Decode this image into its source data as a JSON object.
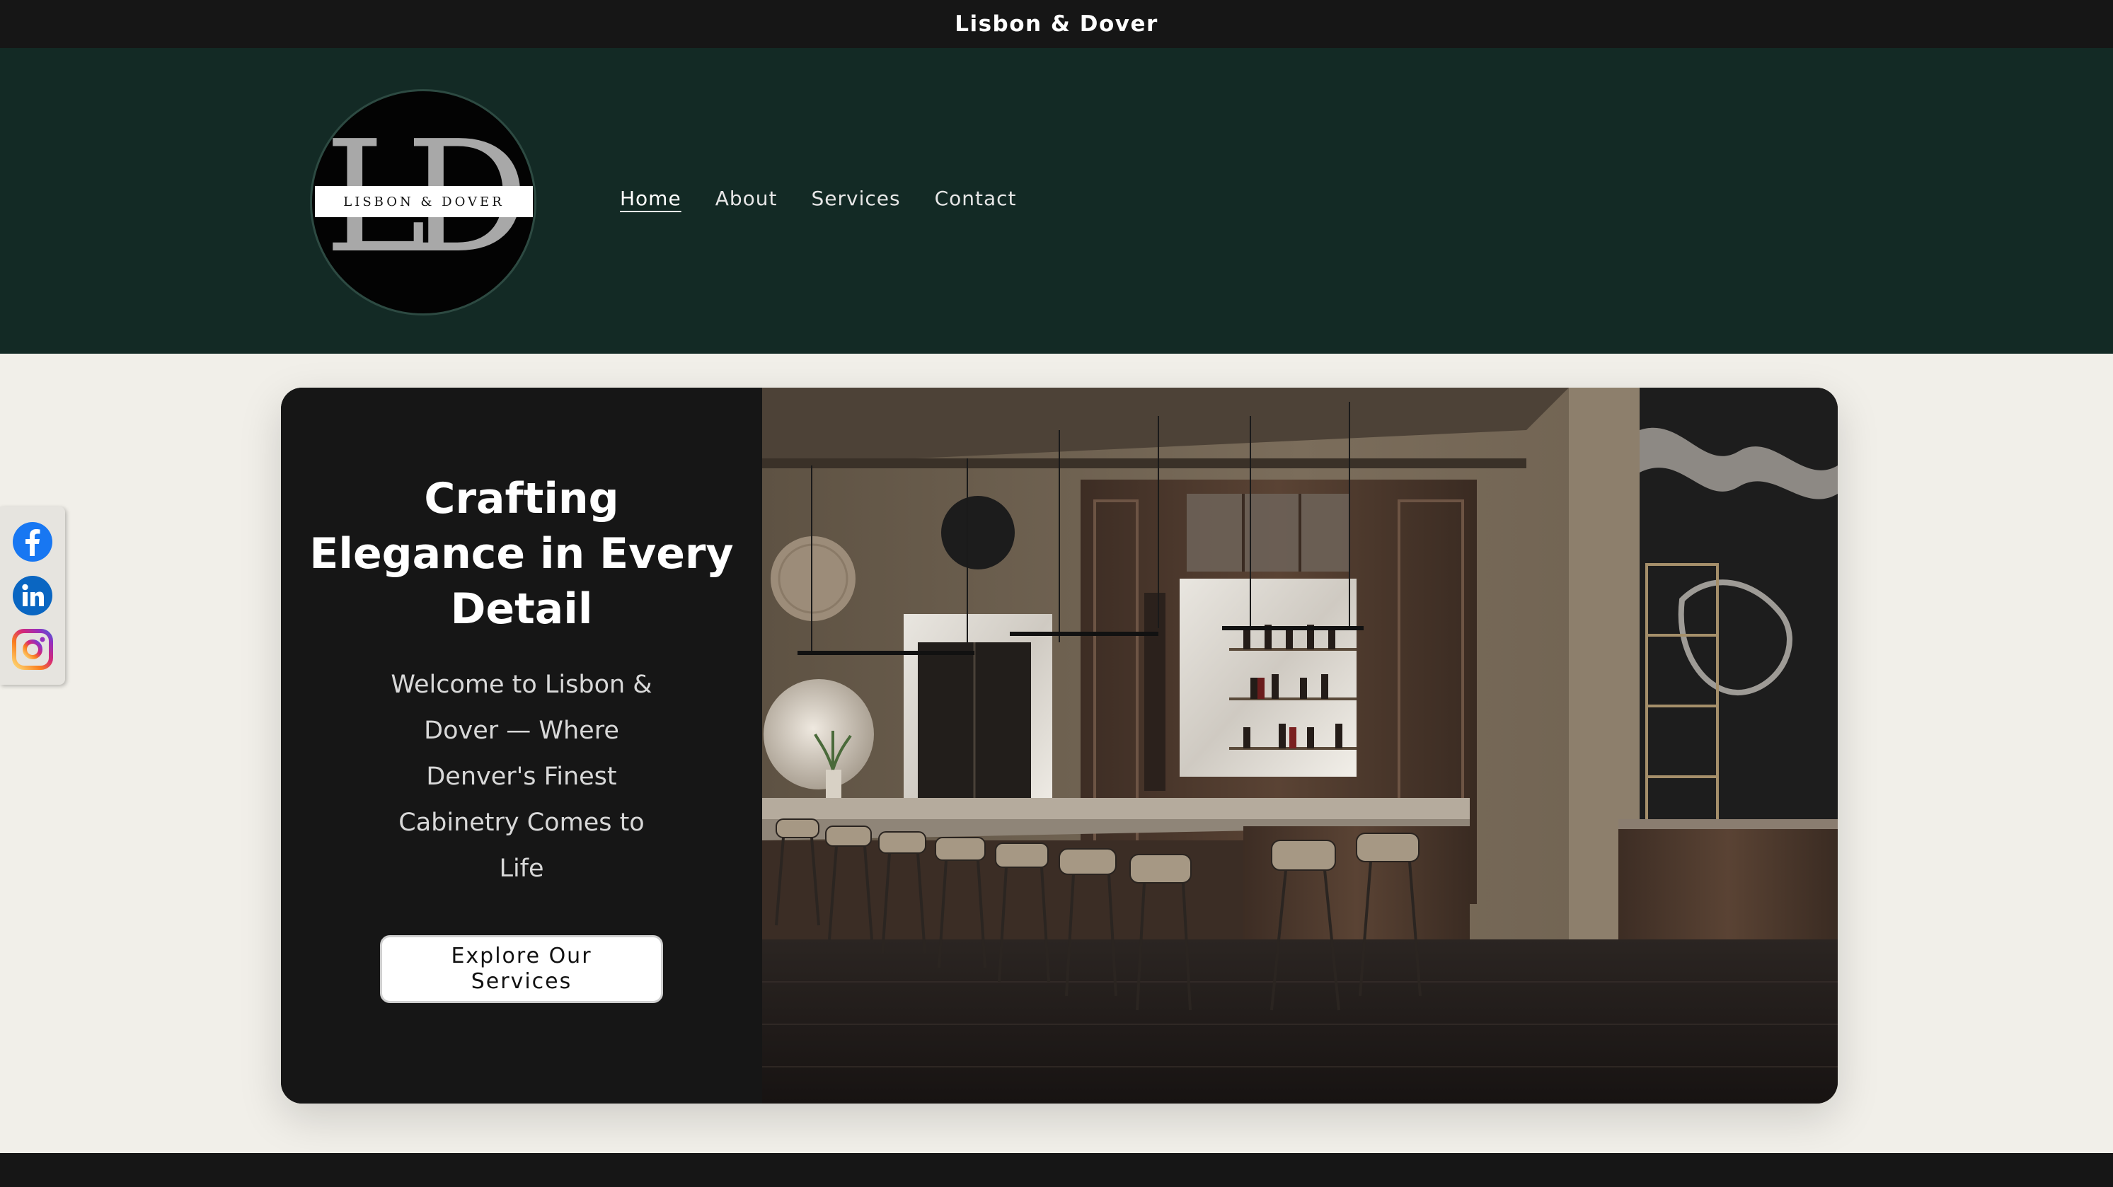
{
  "announcement": {
    "text": "Lisbon & Dover"
  },
  "logo": {
    "letters": "LD",
    "band_text": "LISBON & DOVER"
  },
  "nav": {
    "items": [
      {
        "label": "Home",
        "active": true
      },
      {
        "label": "About",
        "active": false
      },
      {
        "label": "Services",
        "active": false
      },
      {
        "label": "Contact",
        "active": false
      }
    ]
  },
  "hero": {
    "title": "Crafting Elegance in Every Detail",
    "subtitle": "Welcome to Lisbon & Dover — Where Denver's Finest Cabinetry Comes to Life",
    "cta_label": "Explore Our Services",
    "image_icon": "kitchen-bar-photo"
  },
  "social": {
    "items": [
      {
        "icon": "facebook-icon",
        "color": "#1877f2"
      },
      {
        "icon": "linkedin-icon",
        "color": "#0a66c2"
      },
      {
        "icon": "instagram-icon",
        "color": "#c13584"
      }
    ]
  },
  "colors": {
    "announcement_bg": "#161616",
    "header_bg": "#132a25",
    "page_bg": "#f1efe9",
    "hero_panel_bg": "#161616"
  }
}
